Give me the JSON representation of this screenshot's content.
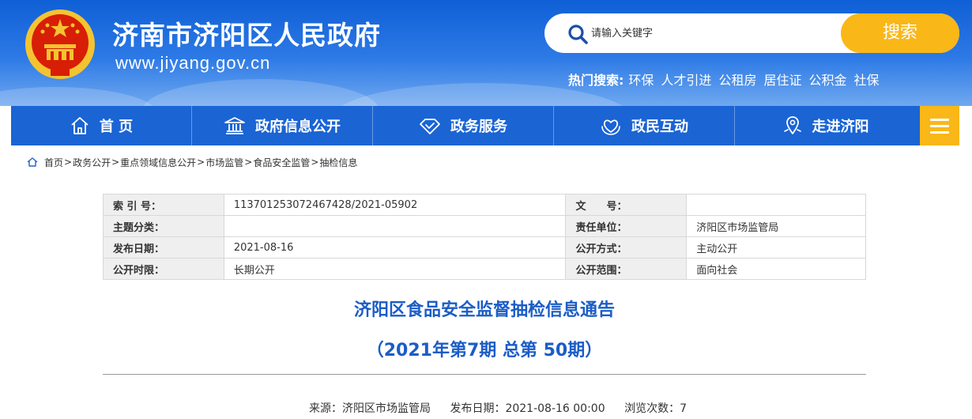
{
  "site": {
    "title": "济南市济阳区人民政府",
    "url": "www.jiyang.gov.cn"
  },
  "search": {
    "placeholder": "请输入关键字",
    "button_label": "搜索"
  },
  "hot_search": {
    "label": "热门搜索:",
    "items": [
      "环保",
      "人才引进",
      "公租房",
      "居住证",
      "公积金",
      "社保"
    ]
  },
  "nav": {
    "items": [
      {
        "label": "首 页",
        "icon": "home-icon"
      },
      {
        "label": "政府信息公开",
        "icon": "government-building-icon"
      },
      {
        "label": "政务服务",
        "icon": "handshake-icon"
      },
      {
        "label": "政民互动",
        "icon": "heart-hands-icon"
      },
      {
        "label": "走进济阳",
        "icon": "location-pin-icon"
      }
    ],
    "menu_icon": "hamburger-menu-icon"
  },
  "breadcrumb": {
    "items": [
      "首页",
      "政务公开",
      "重点领域信息公开",
      "市场监管",
      "食品安全监管",
      "抽检信息"
    ],
    "separator": ">"
  },
  "info_table": {
    "rows": [
      {
        "label1": "索 引 号：",
        "value1": "113701253072467428/2021-05902",
        "label2": "文　　号：",
        "value2": ""
      },
      {
        "label1": "主题分类：",
        "value1": "",
        "label2": "责任单位：",
        "value2": "济阳区市场监管局"
      },
      {
        "label1": "发布日期：",
        "value1": "2021-08-16",
        "label2": "公开方式：",
        "value2": "主动公开"
      },
      {
        "label1": "公开时限：",
        "value1": "长期公开",
        "label2": "公开范围：",
        "value2": "面向社会"
      }
    ]
  },
  "article": {
    "title": "济阳区食品安全监督抽检信息通告",
    "subtitle": "（2021年第7期 总第 50期）",
    "source": "来源：济阳区市场监管局",
    "publish_date": "发布日期：2021-08-16 00:00",
    "views": "浏览次数：7"
  },
  "colors": {
    "primary_blue": "#1a64d4",
    "accent_yellow": "#f9b718",
    "title_blue": "#1b5cc7"
  }
}
